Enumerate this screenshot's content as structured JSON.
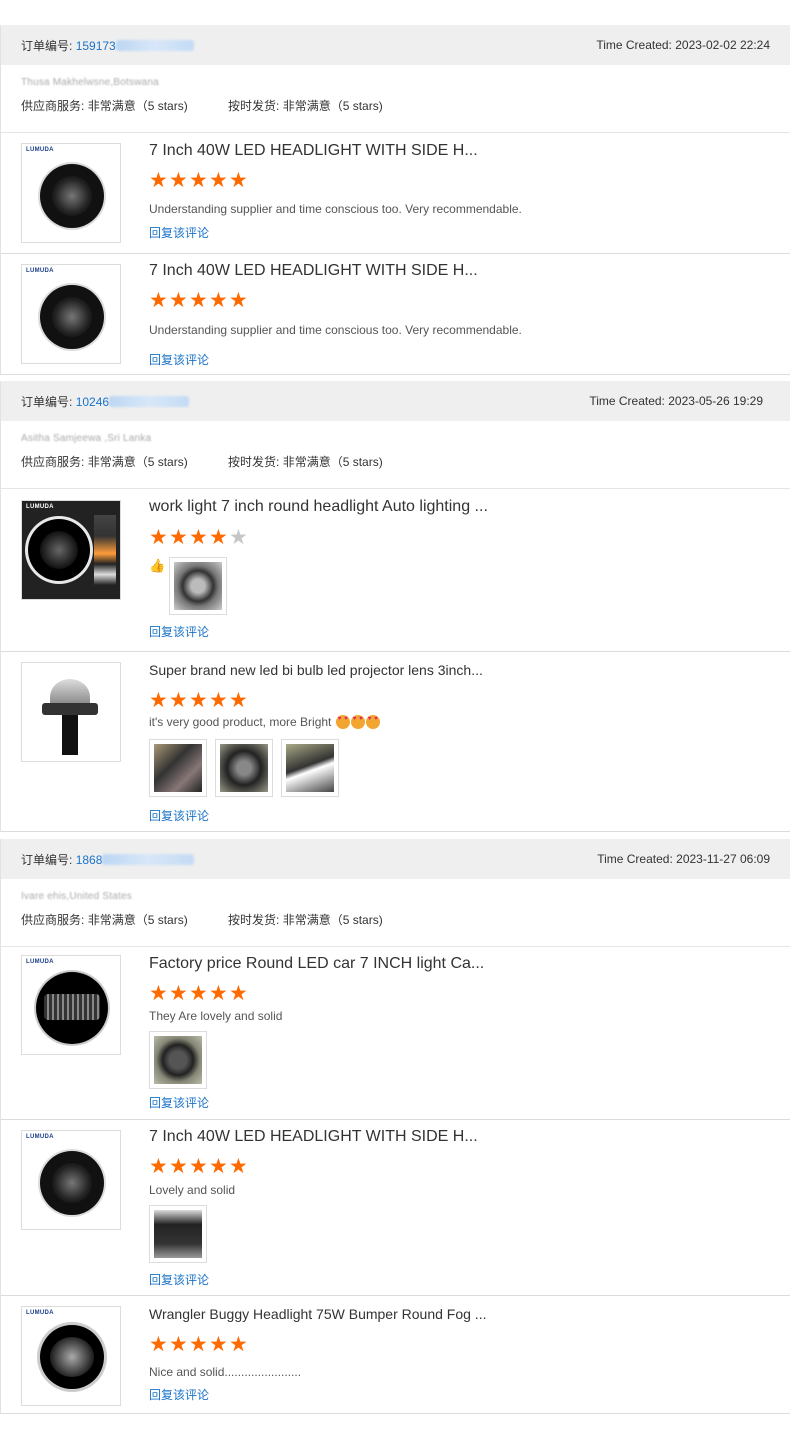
{
  "labels": {
    "order_no": "订单编号:",
    "time_created": "Time Created:",
    "supplier_service": "供应商服务:",
    "on_time_delivery": "按时发货:",
    "reply": "回复该评论"
  },
  "orders": [
    {
      "number_visible": "159173",
      "time": "2023-02-02 22:24",
      "buyer": "Thusa Makhelwsne,Botswana",
      "supplier_rating": "非常满意（5 stars)",
      "delivery_rating": "非常满意（5 stars)",
      "items": [
        {
          "title": "7 Inch 40W LED HEADLIGHT WITH SIDE H...",
          "stars": 5,
          "comment": "Understanding supplier and time conscious too. Very recommendable.",
          "reply": "回复该评论"
        },
        {
          "title": "7 Inch 40W LED HEADLIGHT WITH SIDE H...",
          "stars": 5,
          "comment": "Understanding supplier and time conscious too. Very recommendable.",
          "reply": "回复该评论"
        }
      ]
    },
    {
      "number_visible": "10246",
      "time": "2023-05-26 19:29",
      "buyer": "Asitha Samjeewa ,Sri Lanka",
      "supplier_rating": "非常满意（5 stars)",
      "delivery_rating": "非常满意（5 stars)",
      "items": [
        {
          "title": "work light 7 inch round headlight Auto lighting ...",
          "stars": 4,
          "comment": "👍",
          "photos": 1,
          "reply": "回复该评论"
        },
        {
          "title": "Super brand new led bi bulb led projector lens 3inch...",
          "stars": 5,
          "comment": "it's very good product, more Bright",
          "photos": 3,
          "reply": "回复该评论"
        }
      ]
    },
    {
      "number_visible": "1868",
      "time": "2023-11-27 06:09",
      "buyer": "Ivare ehis,United States",
      "supplier_rating": "非常满意（5 stars)",
      "delivery_rating": "非常满意（5 stars)",
      "items": [
        {
          "title": "Factory price Round LED car 7 INCH light Ca...",
          "stars": 5,
          "comment": "They Are lovely and solid",
          "photos": 1,
          "reply": "回复该评论"
        },
        {
          "title": "7 Inch 40W LED HEADLIGHT WITH SIDE H...",
          "stars": 5,
          "comment": "Lovely and solid",
          "photos": 1,
          "reply": "回复该评论"
        },
        {
          "title": "Wrangler Buggy Headlight 75W Bumper Round Fog ...",
          "stars": 5,
          "comment": "Nice and solid.......................",
          "reply": "回复该评论"
        }
      ]
    }
  ],
  "brand_logo": "LUMUDA",
  "colors": {
    "star_on": "#ff6a00",
    "star_off": "#c6c6c6",
    "link": "#1a73c8",
    "header_bg": "#efefef"
  }
}
